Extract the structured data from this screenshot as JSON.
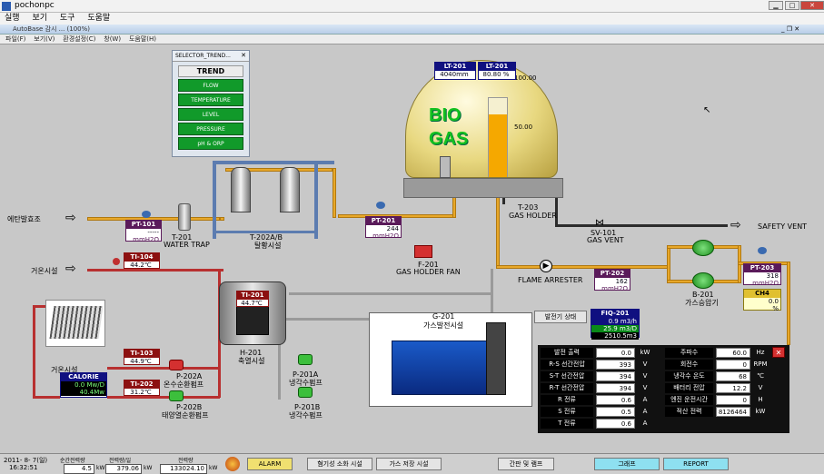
{
  "window": {
    "title": "pochonpc",
    "menu": [
      "실행",
      "보기",
      "도구",
      "도움말"
    ]
  },
  "app": {
    "title": "AutoBase 감시 ... (100%)",
    "menu": [
      "파일(F)",
      "보기(V)",
      "환경설정(C)",
      "창(W)",
      "도움말(H)"
    ]
  },
  "trend": {
    "window_title": "SELECTOR_TREND...",
    "title": "TREND",
    "items": [
      "FLOW",
      "TEMPERATURE",
      "LEVEL",
      "PRESSURE",
      "pH & ORP"
    ]
  },
  "gas_holder": {
    "text1": "BIO",
    "text2": "GAS",
    "scale_top": "100.00",
    "scale_mid": "50.00",
    "fill_fraction": 0.8,
    "lt201a": {
      "tag": "LT-201",
      "value": "4040mm"
    },
    "lt201b": {
      "tag": "LT-201",
      "value": "80.80 %"
    },
    "name": "T-203",
    "desc": "GAS HOLDER"
  },
  "labels": {
    "digester_in": "에탄발효조",
    "water_trap_id": "T-201",
    "water_trap": "WATER TRAP",
    "desulf_id": "T-202A/B",
    "desulf": "탈황시설",
    "fan_id": "F-201",
    "fan": "GAS HOLDER FAN",
    "flame": "FLAME ARRESTER",
    "vent_id": "SV-101",
    "vent": "GAS VENT",
    "safety_vent": "SAFETY VENT",
    "booster_id": "B-201",
    "booster": "가스승압기",
    "gen_id": "G-201",
    "gen": "가스발전시설",
    "gen_status_btn": "발전기 상태",
    "heater_id": "H-201",
    "heater": "축열시설",
    "hot_in": "거온시설",
    "hot_out": "거온시설",
    "p202a_id": "P-202A",
    "p202a": "온수순환펌프",
    "p202b_id": "P-202B",
    "p202b": "태양열순환펌프",
    "p201a_id": "P-201A",
    "p201a": "냉각수펌프",
    "p201b_id": "P-201B",
    "p201b": "냉각수펌프"
  },
  "tags": {
    "pt101": {
      "tag": "PT-101",
      "v1": "-----",
      "v2": "mmH2O"
    },
    "pt201": {
      "tag": "PT-201",
      "v1": "244",
      "v2": "mmH2O"
    },
    "pt202": {
      "tag": "PT-202",
      "v1": "162",
      "v2": "mmH2O"
    },
    "pt203": {
      "tag": "PT-203",
      "v1": "318",
      "v2": "mmH2O"
    },
    "ch4": {
      "tag": "CH4",
      "v1": "0.0",
      "v2": "%"
    },
    "ti104": {
      "tag": "TI-104",
      "v1": "44.2℃"
    },
    "ti201": {
      "tag": "TI-201",
      "v1": "44.7℃"
    },
    "ti103": {
      "tag": "TI-103",
      "v1": "44.9℃"
    },
    "ti202": {
      "tag": "TI-202",
      "v1": "31.2℃"
    },
    "calorie": {
      "tag": "CALORIE",
      "v1": "0.0 Mw/D",
      "v2": "40.4Mw"
    },
    "fiq201": {
      "tag": "FIQ-201",
      "v1": "0.9 m3/h",
      "v2": "25.9 m3/D",
      "v3": "2510.5m3"
    }
  },
  "gen_table": {
    "left": [
      {
        "label": "발전 출력",
        "value": "0.0",
        "unit": "kW"
      },
      {
        "label": "R-S 선간전압",
        "value": "393",
        "unit": "V"
      },
      {
        "label": "S-T 선간전압",
        "value": "394",
        "unit": "V"
      },
      {
        "label": "R-T 선간전압",
        "value": "394",
        "unit": "V"
      },
      {
        "label": "R 전류",
        "value": "0.6",
        "unit": "A"
      },
      {
        "label": "S 전류",
        "value": "0.5",
        "unit": "A"
      },
      {
        "label": "T 전류",
        "value": "0.6",
        "unit": "A"
      }
    ],
    "right": [
      {
        "label": "주파수",
        "value": "60.0",
        "unit": "Hz"
      },
      {
        "label": "회전수",
        "value": "0",
        "unit": "RPM"
      },
      {
        "label": "냉각수 온도",
        "value": "68",
        "unit": "℃"
      },
      {
        "label": "배터리 전압",
        "value": "12.2",
        "unit": "V"
      },
      {
        "label": "엔진 운전시간",
        "value": "0",
        "unit": "H"
      },
      {
        "label": "적산 전력",
        "value": "8126464",
        "unit": "kW"
      }
    ]
  },
  "status": {
    "date": "2011- 8- 7(일)",
    "time": "16:32:51",
    "inst_label": "순간전력량",
    "inst_value": "4.5",
    "inst_unit": "kW",
    "day_label": "전력량/일",
    "day_value": "379.06",
    "day_unit": "kW",
    "total_label": "전력량",
    "total_value": "133024.10",
    "total_unit": "kW",
    "alarm": "ALARM",
    "btn1": "혐기성 소화 시설",
    "btn2": "가스 저장 시설",
    "btn3": "간판 및 램프",
    "btn4": "그래프",
    "btn5": "REPORT"
  },
  "colors": {
    "pipe_gas": "#e8a82a",
    "pipe_hot": "#b83030",
    "tag_purple": "#5a1a5a",
    "tag_red": "#8c1010",
    "tag_blue": "#101080"
  }
}
